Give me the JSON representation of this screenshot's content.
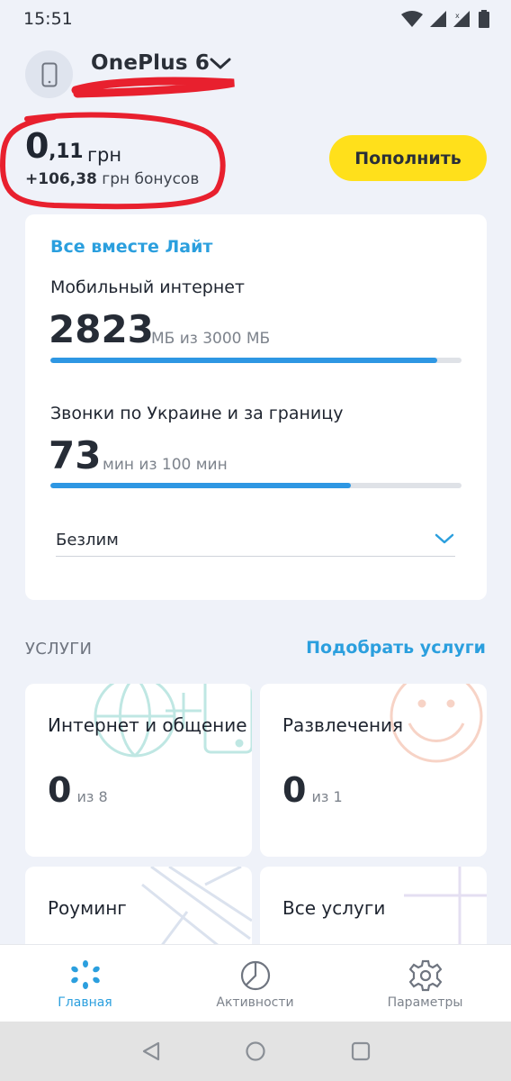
{
  "status_bar": {
    "time": "15:51"
  },
  "header": {
    "device_name": "OnePlus 6",
    "icons": [
      "phone-icon",
      "chevron-down-icon"
    ]
  },
  "balance": {
    "main_integer": "0",
    "main_fraction": ",11",
    "currency": "грн",
    "bonus_amount": "+106,38",
    "bonus_text": "грн бонусов",
    "topup_label": "Пополнить"
  },
  "plan": {
    "name": "Все вместе Лайт",
    "internet": {
      "title": "Мобильный интернет",
      "value": "2823",
      "of_text": "МБ из 3000 МБ",
      "remaining": 2823,
      "total": 3000
    },
    "calls": {
      "title": "Звонки по Украине и за границу",
      "value": "73",
      "of_text": "мин из 100 мин",
      "remaining": 73,
      "total": 100
    },
    "unlimited": {
      "label": "Безлим"
    }
  },
  "services": {
    "title": "УСЛУГИ",
    "link": "Подобрать услуги",
    "tiles": [
      {
        "title": "Интернет и общение",
        "count": "0",
        "of_text": "из 8"
      },
      {
        "title": "Развлечения",
        "count": "0",
        "of_text": "из 1"
      },
      {
        "title": "Роуминг"
      },
      {
        "title": "Все услуги"
      }
    ]
  },
  "bottom_nav": {
    "items": [
      {
        "label": "Главная",
        "icon": "kyivstar-star-icon",
        "active": true
      },
      {
        "label": "Активности",
        "icon": "activity-pie-icon"
      },
      {
        "label": "Параметры",
        "icon": "gear-icon"
      }
    ]
  },
  "colors": {
    "accent_blue": "#2b9fde",
    "topup_yellow": "#ffe01b",
    "progress_blue": "#2e97e3",
    "background": "#eff2f9",
    "annotation_red": "#e8202e"
  }
}
